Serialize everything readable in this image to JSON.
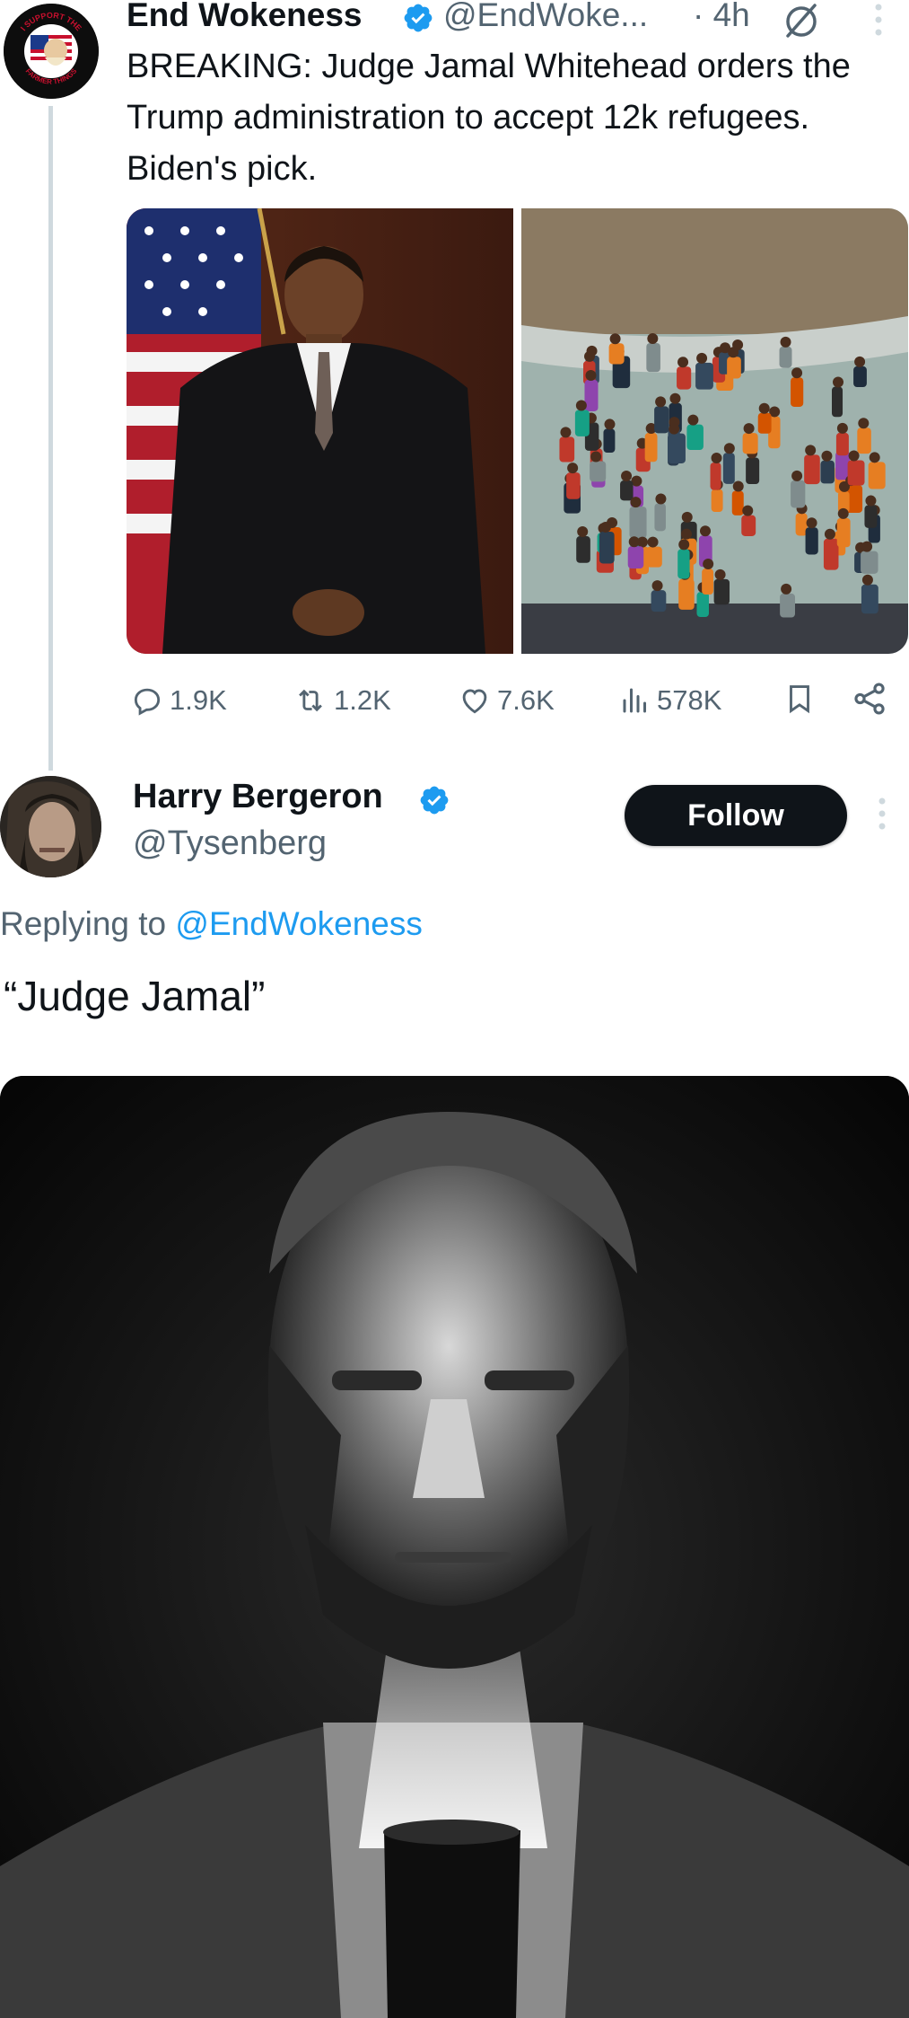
{
  "parent_tweet": {
    "author_name": "End Wokeness",
    "handle": "@EndWoke...",
    "time": "· 4h",
    "text": "BREAKING: Judge Jamal Whitehead orders the Trump administration to accept 12k refugees. Biden's pick.",
    "avatar_text_top": "I SUPPORT THE",
    "avatar_text_bottom": "FARMER THINGS",
    "stats": {
      "replies": "1.9K",
      "retweets": "1.2K",
      "likes": "7.6K",
      "views": "578K"
    }
  },
  "reply_tweet": {
    "author_name": "Harry Bergeron",
    "handle": "@Tysenberg",
    "follow_label": "Follow",
    "replying_to_prefix": "Replying to ",
    "replying_to_handle": "@EndWokeness",
    "text": "“Judge Jamal”"
  },
  "colors": {
    "verified": "#1d9bf0",
    "link": "#1d9bf0",
    "muted": "#536471",
    "thread_line": "#cfd9de",
    "follow_button": "#0f1419"
  },
  "icons": [
    "verified-badge-icon",
    "grok-icon",
    "more-icon",
    "reply-icon",
    "retweet-icon",
    "like-icon",
    "views-icon",
    "bookmark-icon",
    "share-icon"
  ]
}
